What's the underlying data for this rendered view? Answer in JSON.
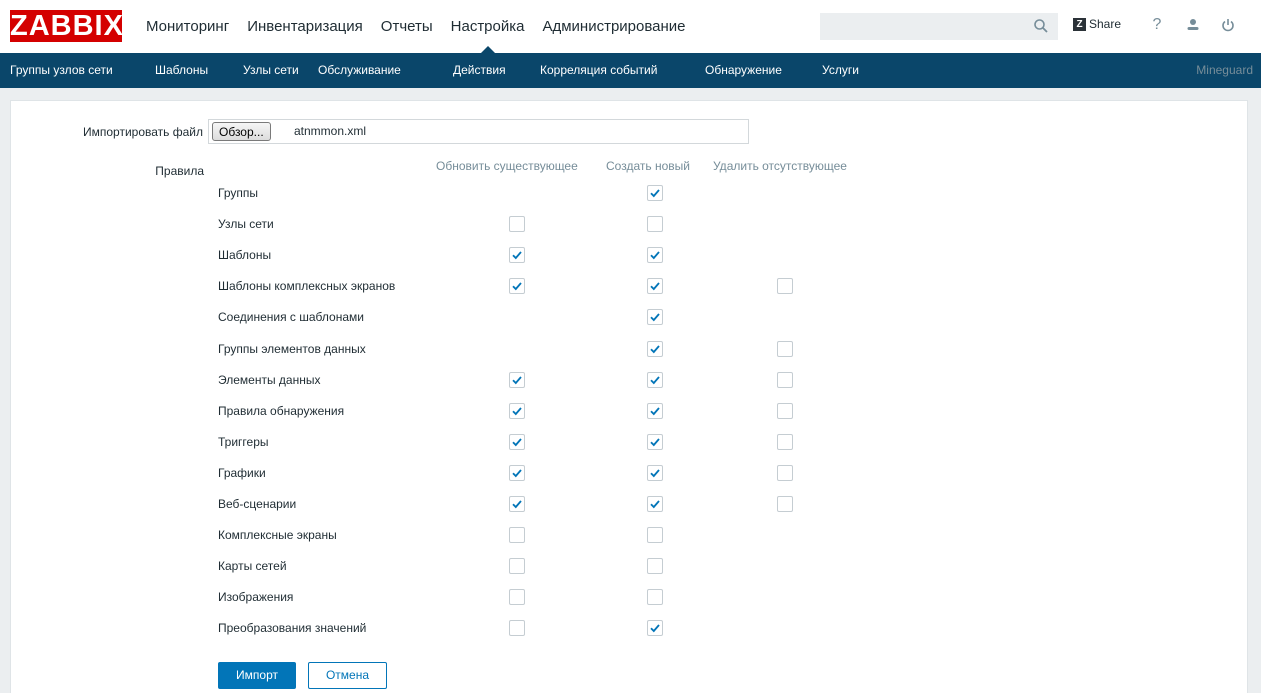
{
  "header": {
    "logo": "ZABBIX",
    "menu": [
      "Мониторинг",
      "Инвентаризация",
      "Отчеты",
      "Настройка",
      "Администрирование"
    ],
    "active_menu": "Настройка",
    "share_label": "Share",
    "share_box": "Z",
    "help_glyph": "?",
    "icons": [
      "search-icon",
      "share-icon",
      "help-icon",
      "user-icon",
      "power-icon"
    ]
  },
  "submenu": {
    "items": [
      "Группы узлов сети",
      "Шаблоны",
      "Узлы сети",
      "Обслуживание",
      "Действия",
      "Корреляция событий",
      "Обнаружение",
      "Услуги"
    ],
    "right_text": "Mineguard"
  },
  "form": {
    "import_file_label": "Импортировать файл",
    "browse_label": "Обзор...",
    "file_name": "atnmmon.xml",
    "rules_label": "Правила",
    "columns": [
      "Обновить существующее",
      "Создать новый",
      "Удалить отсутствующее"
    ],
    "rows": [
      {
        "label": "Группы",
        "update": null,
        "create": true,
        "delete": null
      },
      {
        "label": "Узлы сети",
        "update": false,
        "create": false,
        "delete": null
      },
      {
        "label": "Шаблоны",
        "update": true,
        "create": true,
        "delete": null
      },
      {
        "label": "Шаблоны комплексных экранов",
        "update": true,
        "create": true,
        "delete": false
      },
      {
        "label": "Соединения с шаблонами",
        "update": null,
        "create": true,
        "delete": null
      },
      {
        "label": "Группы элементов данных",
        "update": null,
        "create": true,
        "delete": false
      },
      {
        "label": "Элементы данных",
        "update": true,
        "create": true,
        "delete": false
      },
      {
        "label": "Правила обнаружения",
        "update": true,
        "create": true,
        "delete": false
      },
      {
        "label": "Триггеры",
        "update": true,
        "create": true,
        "delete": false
      },
      {
        "label": "Графики",
        "update": true,
        "create": true,
        "delete": false
      },
      {
        "label": "Веб-сценарии",
        "update": true,
        "create": true,
        "delete": false
      },
      {
        "label": "Комплексные экраны",
        "update": false,
        "create": false,
        "delete": null
      },
      {
        "label": "Карты сетей",
        "update": false,
        "create": false,
        "delete": null
      },
      {
        "label": "Изображения",
        "update": false,
        "create": false,
        "delete": null
      },
      {
        "label": "Преобразования значений",
        "update": false,
        "create": true,
        "delete": null
      }
    ],
    "import_button": "Импорт",
    "cancel_button": "Отмена"
  },
  "colors": {
    "brand_red": "#d40000",
    "nav_blue": "#0a466a",
    "accent_blue": "#0275b8"
  }
}
